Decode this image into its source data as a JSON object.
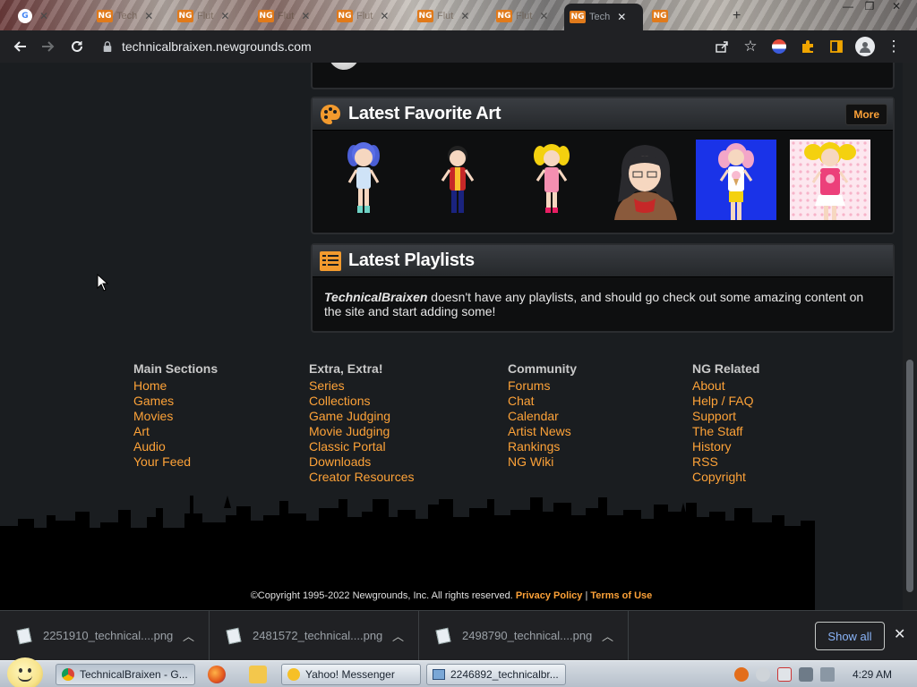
{
  "browser": {
    "tabs": [
      {
        "label": "",
        "icon": "google-favicon"
      },
      {
        "label": "Tech",
        "icon": "newgrounds-favicon"
      },
      {
        "label": "Flut",
        "icon": "newgrounds-favicon"
      },
      {
        "label": "Flut",
        "icon": "newgrounds-favicon"
      },
      {
        "label": "Flut",
        "icon": "newgrounds-favicon"
      },
      {
        "label": "Flut",
        "icon": "newgrounds-favicon"
      },
      {
        "label": "Flut",
        "icon": "newgrounds-favicon"
      },
      {
        "label": "Tech",
        "icon": "newgrounds-favicon",
        "active": true
      },
      {
        "label": "",
        "icon": "newgrounds-favicon"
      }
    ],
    "favicon_text": "NG",
    "url": "technicalbraixen.newgrounds.com"
  },
  "art_panel": {
    "title": "Latest Favorite Art",
    "more_label": "More"
  },
  "playlists_panel": {
    "title": "Latest Playlists",
    "user": "TechnicalBraixen",
    "message": " doesn't have any playlists, and should go check out some amazing content on the site and start adding some!"
  },
  "footer": {
    "columns": [
      {
        "heading": "Main Sections",
        "links": [
          "Home",
          "Games",
          "Movies",
          "Art",
          "Audio",
          "Your Feed"
        ]
      },
      {
        "heading": "Extra, Extra!",
        "links": [
          "Series",
          "Collections",
          "Game Judging",
          "Movie Judging",
          "Classic Portal",
          "Downloads",
          "Creator Resources"
        ]
      },
      {
        "heading": "Community",
        "links": [
          "Forums",
          "Chat",
          "Calendar",
          "Artist News",
          "Rankings",
          "NG Wiki"
        ]
      },
      {
        "heading": "NG Related",
        "links": [
          "About",
          "Help / FAQ",
          "Support",
          "The Staff",
          "History",
          "RSS",
          "Copyright"
        ]
      }
    ],
    "copyright": "©Copyright 1995-2022 Newgrounds, Inc. All rights reserved.",
    "privacy": "Privacy Policy",
    "separator": "|",
    "terms": "Terms of Use"
  },
  "downloads": {
    "items": [
      "2251910_technical....png",
      "2481572_technical....png",
      "2498790_technical....png"
    ],
    "show_all": "Show all"
  },
  "taskbar": {
    "items": [
      {
        "label": "TechnicalBraixen - G...",
        "icon": "chrome-icon"
      },
      {
        "label": "Yahoo! Messenger",
        "icon": "yahoo-messenger-icon"
      },
      {
        "label": "2246892_technicalbr...",
        "icon": "image-viewer-icon"
      }
    ],
    "clock": "4:29 AM"
  },
  "colors": {
    "accent": "#fda238",
    "page_bg": "#1a1d20",
    "panel_bg": "#0e0f10"
  }
}
